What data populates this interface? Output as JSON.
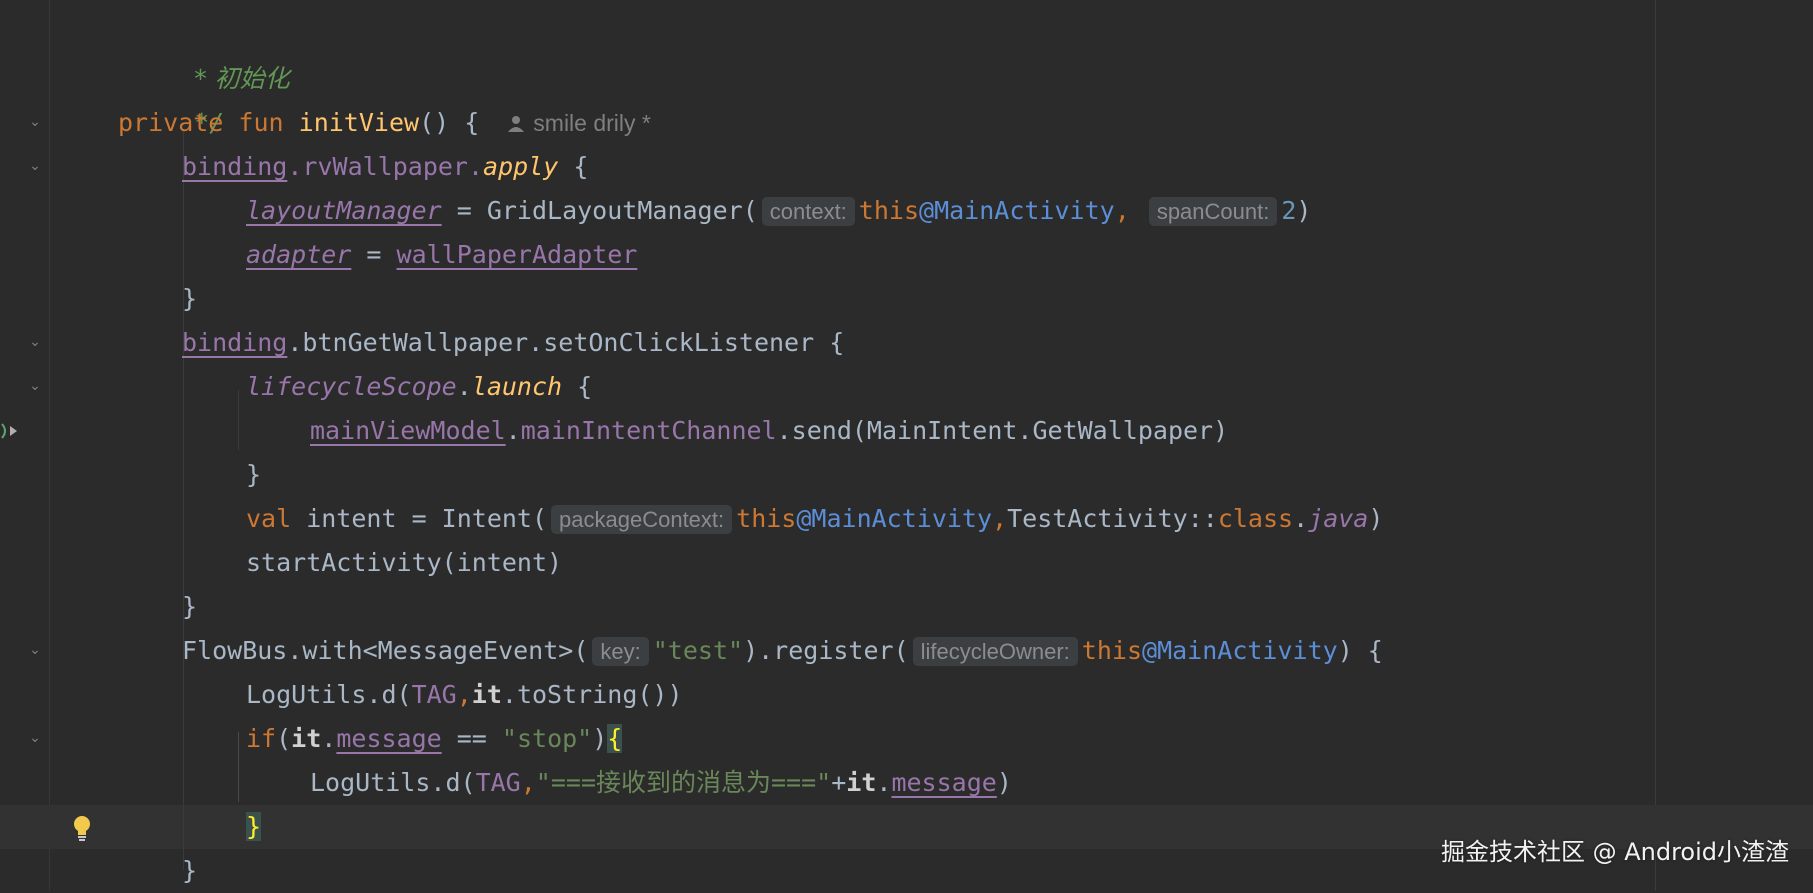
{
  "code": {
    "line1": {
      "comment_text": "* 初始化"
    },
    "line2": {
      "comment_end": "*/"
    },
    "line3": {
      "kw_private": "private",
      "kw_fun": "fun",
      "fn_name": "initView",
      "after_name": "() {",
      "author": "smile drily *"
    },
    "line4": {
      "binding": "binding",
      "dot_rv": ".rvWallpaper.",
      "apply": "apply",
      "brace": " {"
    },
    "line5": {
      "layout_manager": "layoutManager",
      "assign": " = GridLayoutManager(",
      "hint_context": "context:",
      "kw_this": "this",
      "label_main": "@MainActivity",
      "comma": ",",
      "hint_span": "spanCount:",
      "num_two": "2",
      "close": ")"
    },
    "line6": {
      "adapter": "adapter",
      "assign": " = ",
      "wallpaper_adapter": "wallPaperAdapter"
    },
    "line7": {
      "close": "}"
    },
    "line8": {
      "binding": "binding",
      "rest": ".btnGetWallpaper.setOnClickListener {"
    },
    "line9": {
      "lifecycle_scope": "lifecycleScope",
      "dot": ".",
      "launch": "launch",
      "brace": " {"
    },
    "line10": {
      "main_view_model": "mainViewModel",
      "dot": ".",
      "channel": "mainIntentChannel",
      "rest": ".send(MainIntent.GetWallpaper)"
    },
    "line11": {
      "close": "}"
    },
    "line12": {
      "kw_val": "val",
      "rest": " intent = Intent(",
      "hint_package": "packageContext:",
      "kw_this": "this",
      "label_main": "@MainActivity",
      "comma": ",",
      "test_activity": "TestActivity::",
      "kw_class": "class",
      "dot": ".",
      "java": "java",
      "close": ")"
    },
    "line13": {
      "text": "startActivity(intent)"
    },
    "line14": {
      "close": "}"
    },
    "line15": {
      "flowbus": "FlowBus.with<MessageEvent>(",
      "hint_key": "key:",
      "str_test": "\"test\"",
      "register": ").register(",
      "hint_owner": "lifecycleOwner:",
      "kw_this": "this",
      "label_main": "@MainActivity",
      "close": ") {"
    },
    "line16": {
      "log": "LogUtils.d(",
      "tag": "TAG",
      "comma": ",",
      "it": "it",
      "rest": ".toString())"
    },
    "line17": {
      "kw_if": "if",
      "open": "(",
      "it": "it",
      "dot": ".",
      "message": "message",
      "eq": " == ",
      "str_stop": "\"stop\"",
      "close": ")",
      "brace": "{"
    },
    "line18": {
      "log": "LogUtils.d(",
      "tag": "TAG",
      "comma": ",",
      "str_msg": "\"===接收到的消息为===\"",
      "plus": "+",
      "it": "it",
      "dot": ".",
      "message": "message",
      "close": ")"
    },
    "line19": {
      "close": "}"
    },
    "line20": {
      "close": "}"
    }
  },
  "watermark": "掘金技术社区 @ Android小渣渣",
  "colors": {
    "background": "#2b2b2b",
    "keyword": "#cc7832",
    "function": "#ffc66d",
    "property": "#9876aa",
    "string": "#6a8759",
    "number": "#6897bb",
    "label": "#5b8ed6",
    "comment": "#629755"
  },
  "icons": {
    "fold": "chevron-down-icon",
    "bulb": "lightbulb-icon",
    "run": "run-gutter-icon",
    "author": "person-icon"
  }
}
